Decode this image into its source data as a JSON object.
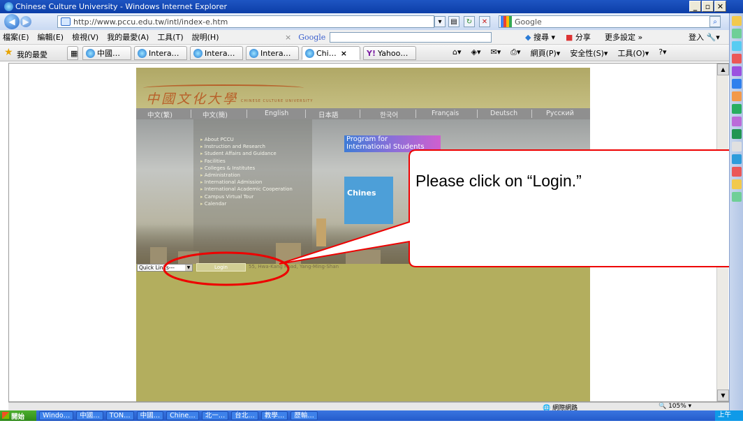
{
  "window": {
    "title": "Chinese Culture University - Windows Internet Explorer"
  },
  "toolbar": {
    "url": "http://www.pccu.edu.tw/intl/index-e.htm",
    "search_placeholder": "Google",
    "google_label": "Google",
    "search_btn": "搜尋",
    "share_btn": "分享",
    "more_settings": "更多設定 »",
    "login_btn": "登入"
  },
  "menu": {
    "file": "檔案(E)",
    "edit": "編輯(E)",
    "view": "檢視(V)",
    "favorites": "我的最愛(A)",
    "tools": "工具(T)",
    "help": "說明(H)"
  },
  "favbar": {
    "favorites": "我的最愛",
    "tabs": [
      "中國…",
      "Intera…",
      "Intera…",
      "Intera…",
      "Chi…",
      "Yahoo…"
    ],
    "page": "網頁(P)",
    "safety": "安全性(S)",
    "tools": "工具(O)"
  },
  "site": {
    "languages": [
      "中文(繁)",
      "中文(簡)",
      "English",
      "日本語",
      "한국어",
      "Français",
      "Deutsch",
      "Русский"
    ],
    "menu_items": [
      "About PCCU",
      "Instruction and Research",
      "Student Affairs and Guidance",
      "Facilities",
      "Colleges & Institutes",
      "Administration",
      "International Admission",
      "International Academic Cooperation",
      "Campus Virtual Tour",
      "Calendar"
    ],
    "program_line1": "Program for",
    "program_line2": "International Students",
    "chinese_label": "Chines",
    "quick_links": "Quick Links---",
    "login": "Login",
    "address": "55, Hwa-Kang Road, Yang-Ming-Shan"
  },
  "callout": {
    "text": "Please click on “Login.”"
  },
  "statusbar": {
    "zone": "網際網路",
    "zoom": "105%"
  },
  "taskbar": {
    "start": "開始",
    "items": [
      "Windo…",
      "中國…",
      "TON…",
      "中國…",
      "Chine…",
      "北一…",
      "台北…",
      "教學…",
      "歷輸…"
    ],
    "time": "上午 11:29"
  }
}
